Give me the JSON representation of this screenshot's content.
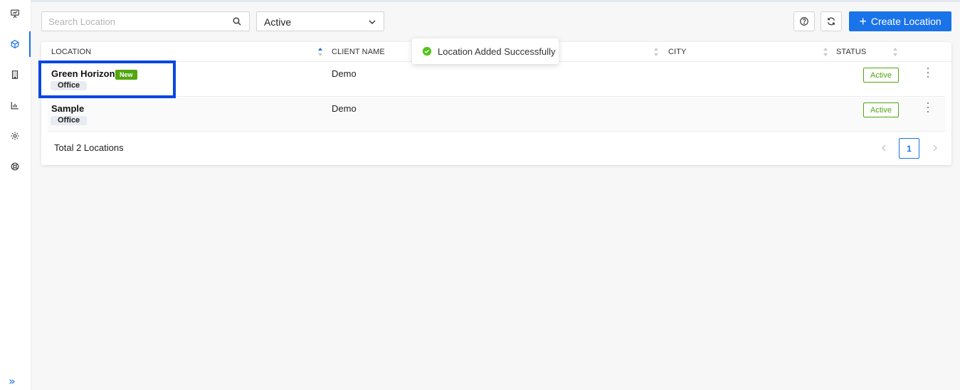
{
  "sidebar": {
    "items": [
      {
        "icon": "presentation-icon"
      },
      {
        "icon": "cube-icon",
        "active": true
      },
      {
        "icon": "building-icon"
      },
      {
        "icon": "bar-chart-icon"
      },
      {
        "icon": "gear-icon"
      },
      {
        "icon": "support-icon"
      }
    ],
    "expand_label": "»"
  },
  "toolbar": {
    "search_placeholder": "Search Location",
    "status_filter_value": "Active",
    "create_label": "Create Location"
  },
  "toast": {
    "message": "Location Added Successfully"
  },
  "table": {
    "columns": [
      "LOCATION",
      "CLIENT NAME",
      "CITY",
      "STATUS"
    ],
    "rows": [
      {
        "name": "Green Horizon",
        "badge": "New",
        "type": "Office",
        "client": "Demo",
        "city": "",
        "status": "Active"
      },
      {
        "name": "Sample",
        "badge": "",
        "type": "Office",
        "client": "Demo",
        "city": "",
        "status": "Active"
      }
    ],
    "total_label": "Total 2 Locations",
    "current_page": "1"
  },
  "colors": {
    "accent": "#1a73e8",
    "success": "#52a60f",
    "highlight": "#0a47e0"
  }
}
